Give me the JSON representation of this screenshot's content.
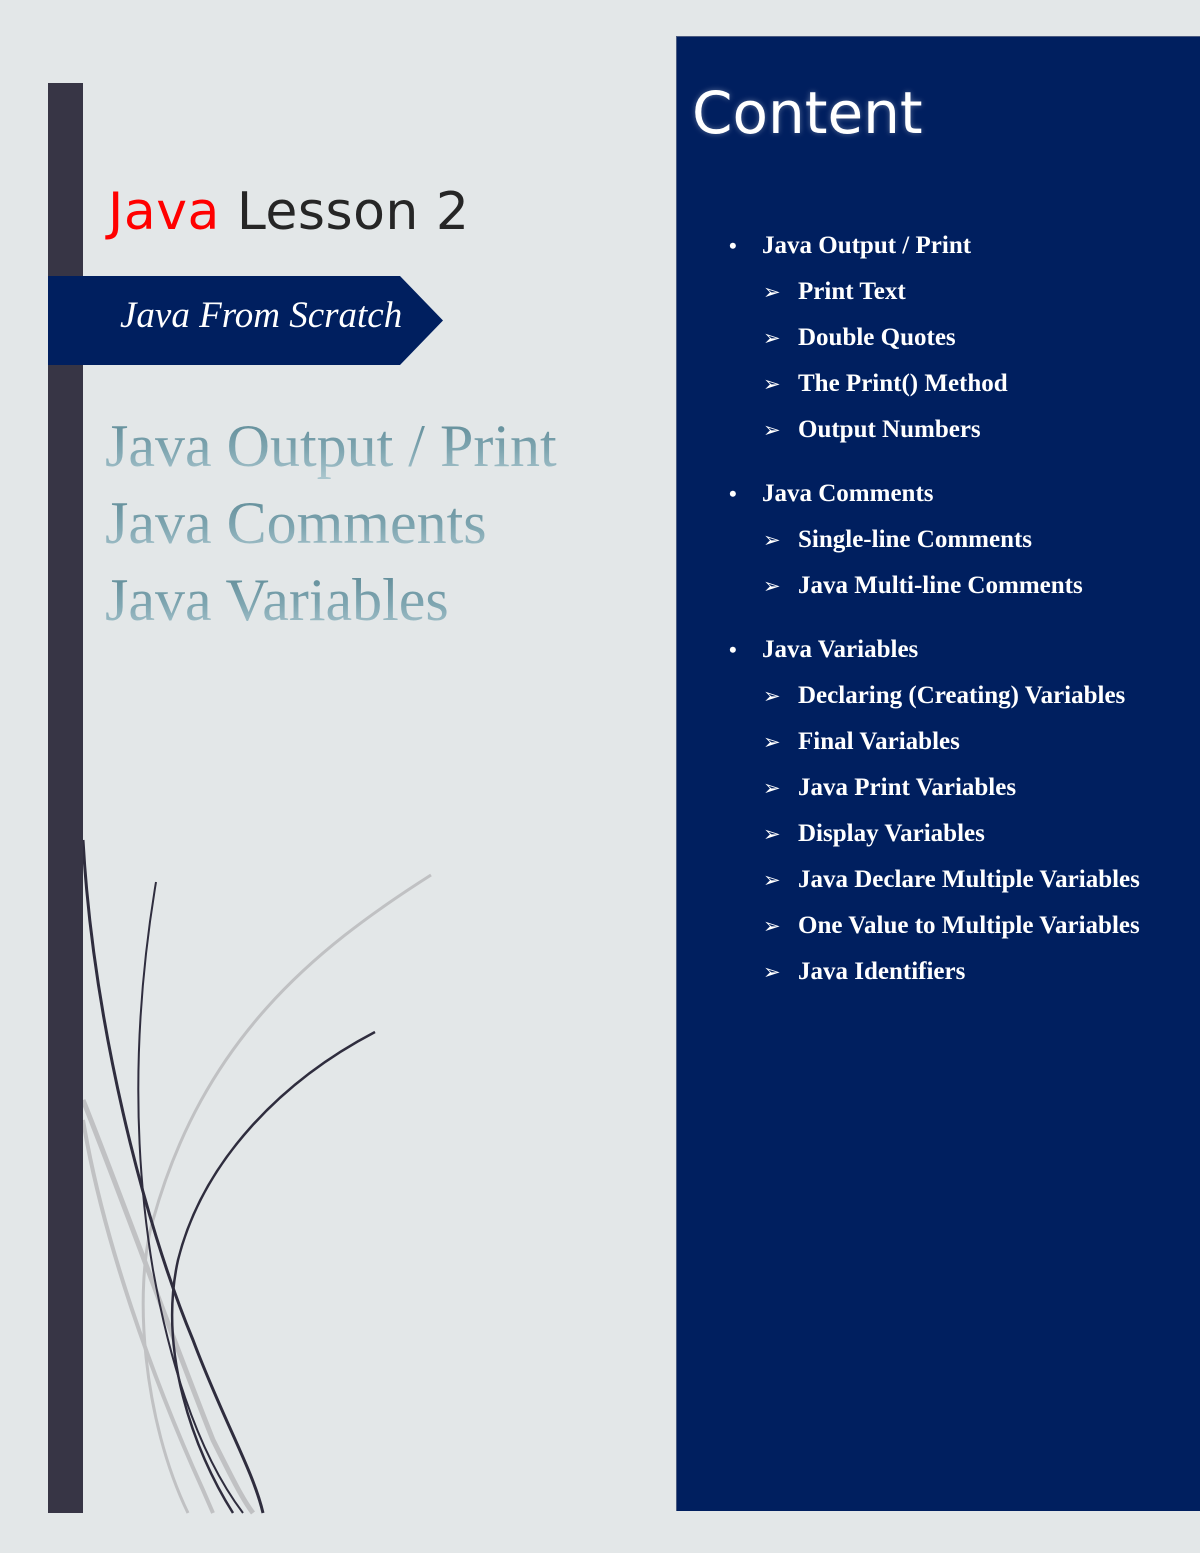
{
  "cover": {
    "title_accent": "Java",
    "title_rest": " Lesson 2",
    "banner": "Java From Scratch",
    "topics": [
      "Java Output / Print",
      "Java Comments",
      "Java Variables"
    ]
  },
  "contents": {
    "heading": "Content",
    "sections": [
      {
        "title": "Java Output / Print",
        "items": [
          "Print Text",
          "Double Quotes",
          "The Print() Method",
          "Output Numbers"
        ]
      },
      {
        "title": "Java Comments",
        "items": [
          "Single-line Comments",
          "Java Multi-line Comments"
        ]
      },
      {
        "title": "Java Variables",
        "items": [
          "Declaring (Creating) Variables",
          "Final Variables",
          "Java Print Variables",
          "Display Variables",
          "Java Declare Multiple Variables",
          "One Value to Multiple Variables",
          "Java Identifiers"
        ]
      }
    ]
  },
  "icons": {
    "bullet": "•",
    "arrow": "➢"
  },
  "colors": {
    "accent": "#ff0000",
    "navy": "#001f5f",
    "bar": "#373545",
    "background": "#e3e7e8"
  }
}
